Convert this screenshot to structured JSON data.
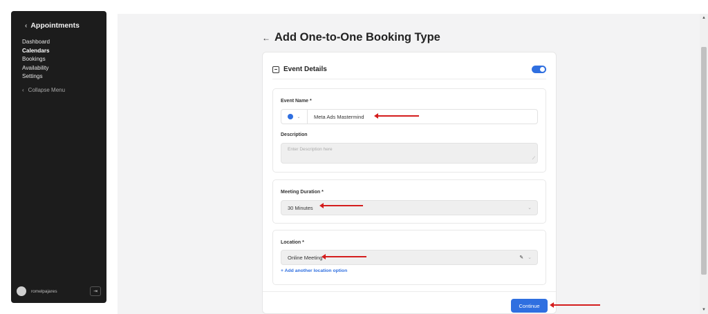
{
  "sidebar": {
    "back_label": "Appointments",
    "items": [
      {
        "label": "Dashboard"
      },
      {
        "label": "Calendars"
      },
      {
        "label": "Bookings"
      },
      {
        "label": "Availability"
      },
      {
        "label": "Settings"
      }
    ],
    "collapse_label": "Collapse Menu",
    "username": "romelpajares"
  },
  "page": {
    "title": "Add One-to-One Booking Type"
  },
  "card": {
    "section_title": "Event Details",
    "toggle_on": true,
    "event_name_label": "Event Name *",
    "event_name_value": "Meta Ads Mastermind",
    "description_label": "Description",
    "description_placeholder": "Enter Description here",
    "duration_label": "Meeting Duration *",
    "duration_value": "30 Minutes",
    "location_label": "Location *",
    "location_value": "Online Meeting",
    "add_location_link": "+ Add another location option",
    "continue_label": "Continue"
  },
  "colors": {
    "accent": "#2f6fe0",
    "sidebar_bg": "#1c1c1c",
    "annotation_arrow": "#d41c1c"
  }
}
